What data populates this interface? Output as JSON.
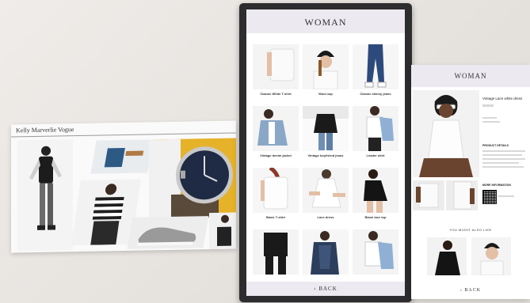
{
  "left_screen": {
    "brand": "Kelly Marverlie Vogue"
  },
  "middle_screen": {
    "title": "WOMAN",
    "products": [
      {
        "name": "Classic White T-shirt"
      },
      {
        "name": "Wool cap"
      },
      {
        "name": "Classic skinny jeans"
      },
      {
        "name": "Vintage denim jacket"
      },
      {
        "name": "Vintage boyfriend jeans"
      },
      {
        "name": "Leader shirt"
      },
      {
        "name": "Basic T-shirt"
      },
      {
        "name": "Lace dress"
      },
      {
        "name": "Black lace top"
      },
      {
        "name": ""
      },
      {
        "name": ""
      },
      {
        "name": ""
      }
    ],
    "back_label": "BACK"
  },
  "right_screen": {
    "title": "WOMAN",
    "product_name": "Vintage Lace white dress",
    "section_details": "PRODUCT DETAILS",
    "section_more": "MORE INFORMATION",
    "you_might_like": "YOU MIGHT ALSO LIKE",
    "back_label": "BACK"
  },
  "colors": {
    "header_bg": "#eceaf0",
    "bezel": "#2d2d2f",
    "watch_bg": "#e6b22a",
    "watch_face": "#1f2a44"
  }
}
